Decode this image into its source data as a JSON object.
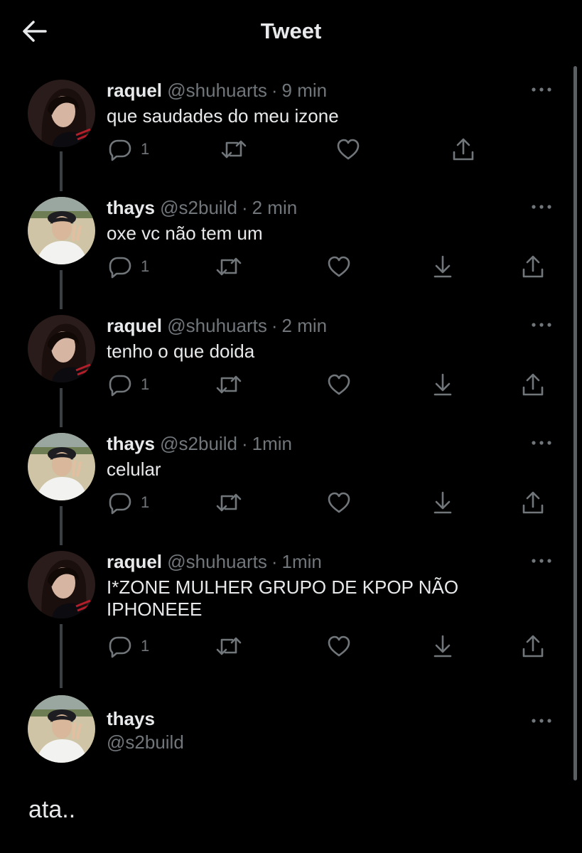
{
  "header": {
    "title": "Tweet",
    "back_icon": "arrow-left-icon"
  },
  "thread": [
    {
      "name": "raquel",
      "handle": "@shuhuarts",
      "sep": "·",
      "time": "9 min",
      "text": "que saudades do meu izone",
      "reply_count": "1",
      "avatar": "raquel",
      "has_download": false
    },
    {
      "name": "thays",
      "handle": "@s2build",
      "sep": "·",
      "time": "2 min",
      "text": "oxe vc não tem um",
      "reply_count": "1",
      "avatar": "thays",
      "has_download": true
    },
    {
      "name": "raquel",
      "handle": "@shuhuarts",
      "sep": "·",
      "time": "2 min",
      "text": "tenho o que doida",
      "reply_count": "1",
      "avatar": "raquel",
      "has_download": true
    },
    {
      "name": "thays",
      "handle": "@s2build",
      "sep": "·",
      "time": "1min",
      "text": "celular",
      "reply_count": "1",
      "avatar": "thays",
      "has_download": true
    },
    {
      "name": "raquel",
      "handle": "@shuhuarts",
      "sep": "·",
      "time": "1min",
      "text": "I*ZONE MULHER GRUPO DE KPOP NÃO IPHONEEE",
      "reply_count": "1",
      "avatar": "raquel",
      "has_download": true
    }
  ],
  "main_tweet": {
    "name": "thays",
    "handle": "@s2build",
    "text": "ata..",
    "avatar": "thays"
  },
  "icons": [
    "reply-icon",
    "retweet-icon",
    "like-icon",
    "download-icon",
    "share-icon",
    "more-icon"
  ],
  "colors": {
    "background": "#000000",
    "text": "#e7e9ea",
    "muted": "#71767b",
    "thread_line": "#3a3f44"
  }
}
